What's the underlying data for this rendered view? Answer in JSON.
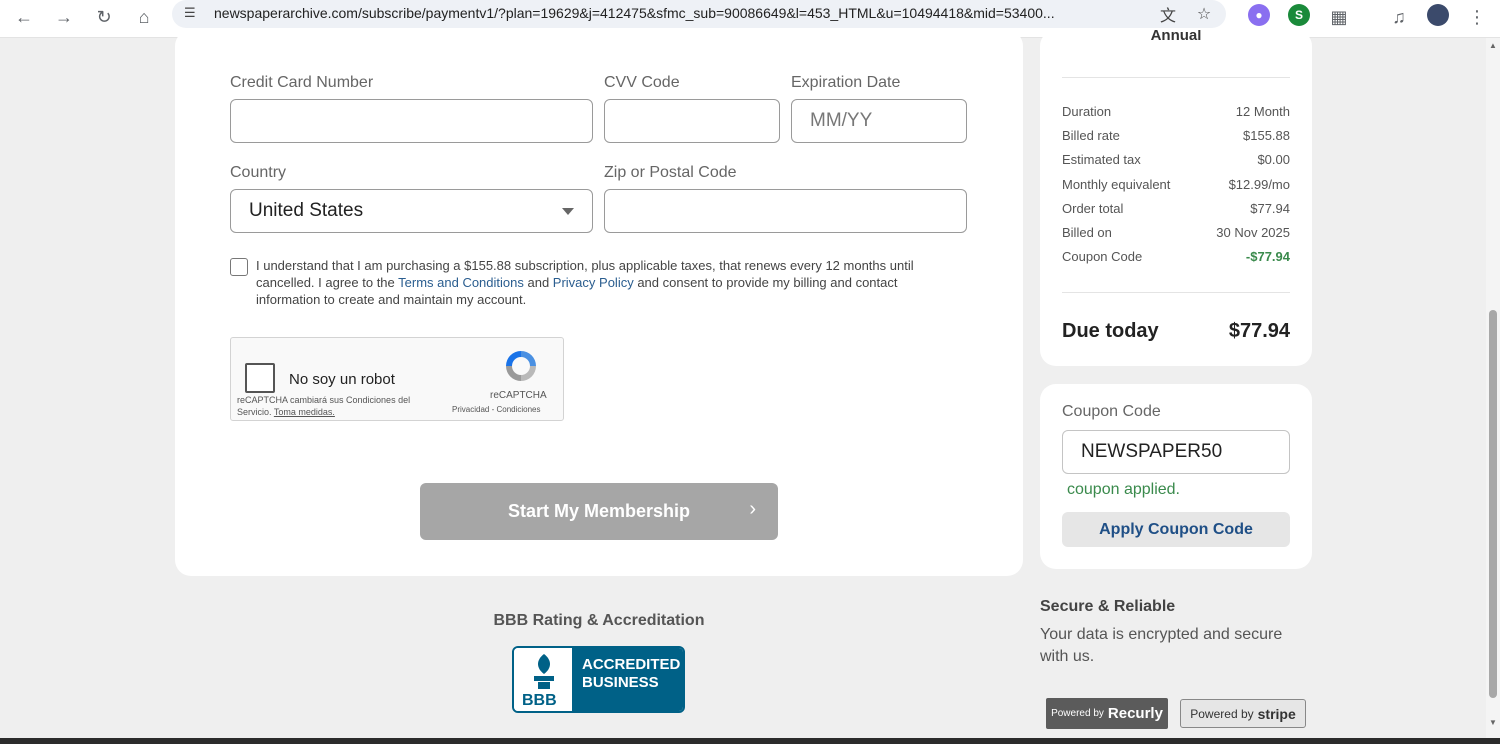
{
  "browser": {
    "url": "newspaperarchive.com/subscribe/paymentv1/?plan=19629&j=412475&sfmc_sub=90086649&l=453_HTML&u=10494418&mid=53400..."
  },
  "form": {
    "credit_card_label": "Credit Card Number",
    "credit_card_value": "",
    "cvv_label": "CVV Code",
    "cvv_value": "",
    "expiration_label": "Expiration Date",
    "expiration_placeholder": "MM/YY",
    "country_label": "Country",
    "country_value": "United States",
    "zip_label": "Zip or Postal Code",
    "zip_value": "",
    "terms_part1": "I understand that I am purchasing a $155.88 subscription, plus applicable taxes, that renews every 12 months until cancelled. I agree to the ",
    "terms_link1": "Terms and Conditions",
    "terms_part2": " and ",
    "terms_link2": "Privacy Policy",
    "terms_part3": " and consent to provide my billing and contact information to create and maintain my account.",
    "submit_label": "Start My Membership"
  },
  "recaptcha": {
    "label": "No soy un robot",
    "note": "reCAPTCHA cambiará sus Condiciones del Servicio.",
    "note_link": "Toma medidas.",
    "brand": "reCAPTCHA",
    "links": "Privacidad - Condiciones"
  },
  "bbb": {
    "title": "BBB Rating & Accreditation",
    "badge_line1": "ACCREDITED",
    "badge_line2": "BUSINESS",
    "logo_text": "BBB"
  },
  "summary": {
    "plan": "Annual",
    "rows": [
      {
        "key": "Duration",
        "value": "12 Month"
      },
      {
        "key": "Billed rate",
        "value": "$155.88"
      },
      {
        "key": "Estimated tax",
        "value": "$0.00"
      },
      {
        "key": "Monthly equivalent",
        "value": "$12.99/mo"
      },
      {
        "key": "Order total",
        "value": "$77.94"
      },
      {
        "key": "Billed on",
        "value": "30 Nov 2025"
      },
      {
        "key": "Coupon Code",
        "value": "-$77.94"
      }
    ],
    "due_label": "Due today",
    "due_value": "$77.94"
  },
  "coupon": {
    "label": "Coupon Code",
    "value": "NEWSPAPER50",
    "message": "coupon applied.",
    "button": "Apply Coupon Code"
  },
  "secure": {
    "title": "Secure & Reliable",
    "text": "Your data is encrypted and secure with us."
  },
  "powered": {
    "recurly_prefix": "Powered by",
    "recurly_brand": "Recurly",
    "stripe_prefix": "Powered by",
    "stripe_brand": "stripe"
  },
  "colors": {
    "accent_green": "#3a8a4c",
    "link_blue": "#2a5d8f",
    "bbb_blue": "#006187",
    "button_disabled": "#a6a6a6"
  }
}
